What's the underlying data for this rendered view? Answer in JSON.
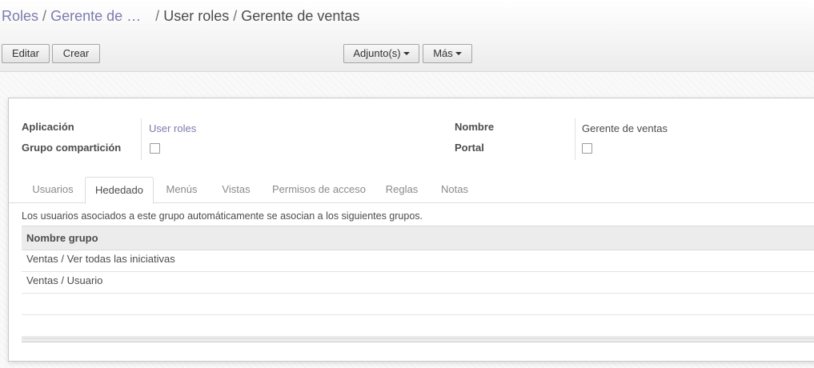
{
  "breadcrumb": {
    "items": [
      "Roles",
      "Gerente de …",
      "User roles"
    ],
    "separator": "/",
    "current": "Gerente de ventas"
  },
  "buttons": {
    "edit": "Editar",
    "create": "Crear",
    "attachments": "Adjunto(s)",
    "more": "Más"
  },
  "form": {
    "app_label": "Aplicación",
    "app_value": "User roles",
    "share_label": "Grupo compartición",
    "name_label": "Nombre",
    "name_value": "Gerente de ventas",
    "portal_label": "Portal"
  },
  "tabs": [
    "Usuarios",
    "Hededado",
    "Menús",
    "Vistas",
    "Permisos de acceso",
    "Reglas",
    "Notas"
  ],
  "active_tab": "Hededado",
  "inherited": {
    "description": "Los usuarios asociados a este grupo automáticamente se asocian a los siguientes grupos.",
    "column_header": "Nombre grupo",
    "rows": [
      "Ventas / Ver todas las iniciativas",
      "Ventas / Usuario"
    ]
  },
  "colors": {
    "link": "#7c7bad",
    "text": "#4c4c4c"
  }
}
